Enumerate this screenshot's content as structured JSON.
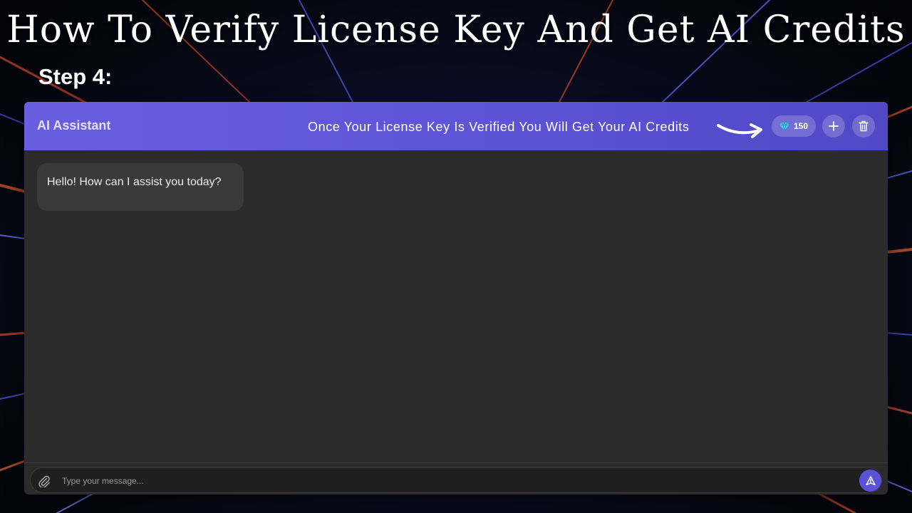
{
  "heading": "How To Verify License Key And Get AI Credits",
  "step": "Step 4:",
  "app": {
    "title": "AI Assistant",
    "annotation": "Once Your License Key Is Verified You Will Get Your AI Credits",
    "credits": {
      "icon": "gem-icon",
      "count": "150"
    },
    "buttons": [
      {
        "icon": "plus-icon"
      },
      {
        "icon": "trash-icon"
      }
    ],
    "accent": "#5b52d6"
  },
  "chat": {
    "messages": [
      {
        "role": "assistant",
        "text": "Hello! How can I assist you today?"
      }
    ]
  },
  "composer": {
    "placeholder": "Type your message...",
    "attach_icon": "paperclip-icon",
    "send_icon": "send-icon"
  }
}
